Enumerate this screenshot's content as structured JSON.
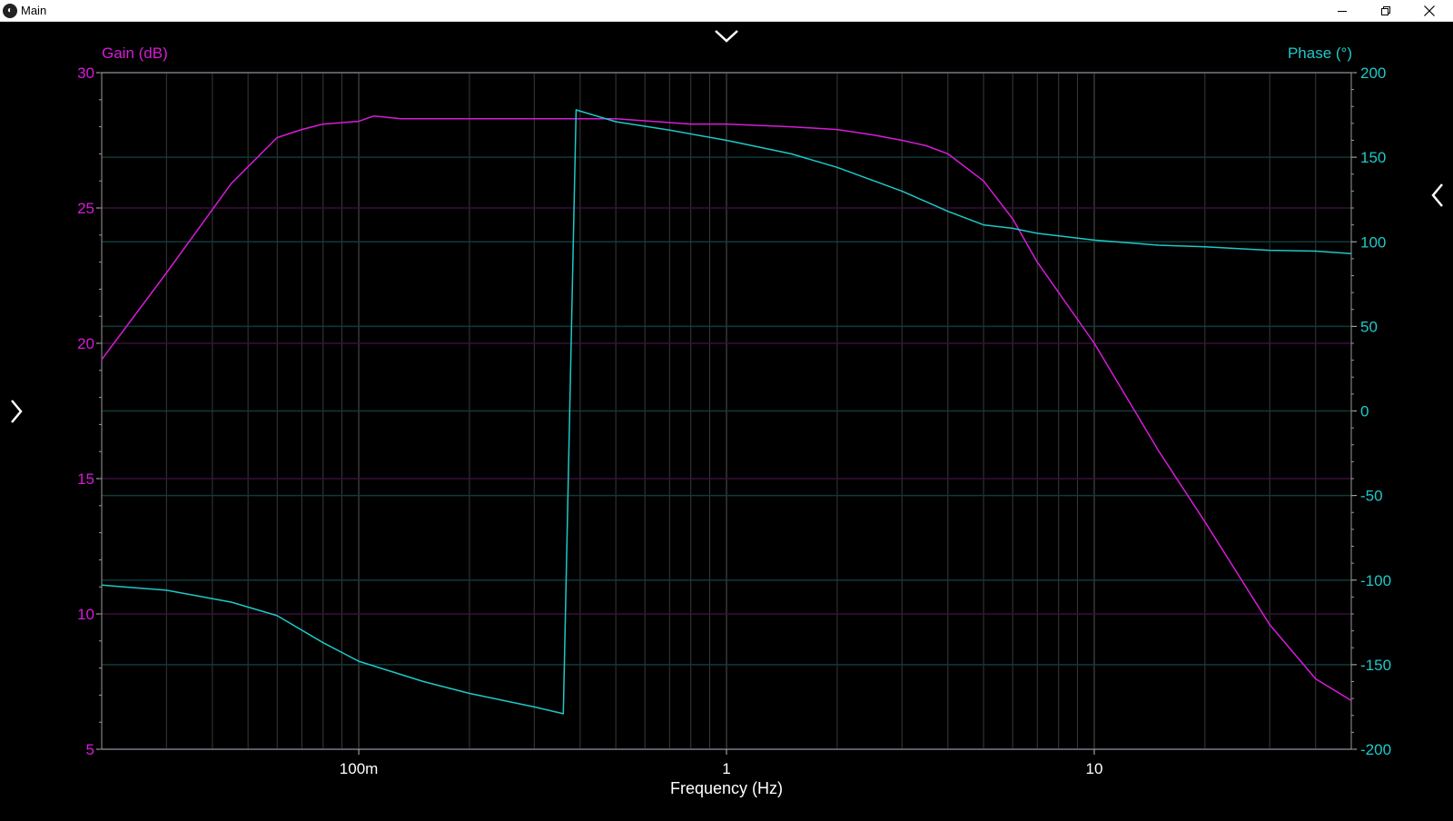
{
  "window": {
    "title": "Main",
    "icon": "app-logo-icon",
    "controls": [
      "minimize-icon",
      "restore-icon",
      "close-icon"
    ]
  },
  "nav": {
    "top_toggle_icon": "chevron-down-icon",
    "left_toggle_icon": "chevron-right-icon",
    "right_toggle_icon": "chevron-left-icon"
  },
  "colors": {
    "background": "#000000",
    "gain": "#d81bd8",
    "phase": "#1ec8c8",
    "gain_grid": "#3a0f3a",
    "phase_grid": "#0f3a3a",
    "freq_grid": "#3a3a3a",
    "axis_text": "#ffffff"
  },
  "chart_data": {
    "type": "line",
    "xlabel": "Frequency (Hz)",
    "xscale": "log",
    "xlim": [
      0.02,
      50
    ],
    "xticks": [
      {
        "value": 0.1,
        "label": "100m"
      },
      {
        "value": 1,
        "label": "1"
      },
      {
        "value": 10,
        "label": "10"
      }
    ],
    "y_left": {
      "label": "Gain (dB)",
      "lim": [
        5,
        30
      ],
      "ticks": [
        5,
        10,
        15,
        20,
        25,
        30
      ]
    },
    "y_right": {
      "label": "Phase (°)",
      "lim": [
        -200,
        200
      ],
      "ticks": [
        -200,
        -150,
        -100,
        -50,
        0,
        50,
        100,
        150,
        200
      ]
    },
    "grid": true,
    "series": [
      {
        "name": "Gain (dB)",
        "axis": "left",
        "color": "#d81bd8",
        "points": [
          [
            0.02,
            19.4
          ],
          [
            0.03,
            22.6
          ],
          [
            0.045,
            25.9
          ],
          [
            0.06,
            27.6
          ],
          [
            0.07,
            27.9
          ],
          [
            0.08,
            28.1
          ],
          [
            0.1,
            28.2
          ],
          [
            0.11,
            28.4
          ],
          [
            0.13,
            28.3
          ],
          [
            0.2,
            28.3
          ],
          [
            0.3,
            28.3
          ],
          [
            0.5,
            28.3
          ],
          [
            0.8,
            28.1
          ],
          [
            1.0,
            28.1
          ],
          [
            1.5,
            28.0
          ],
          [
            2.0,
            27.9
          ],
          [
            2.5,
            27.7
          ],
          [
            3.0,
            27.5
          ],
          [
            3.5,
            27.3
          ],
          [
            4.0,
            27.0
          ],
          [
            5.0,
            26.0
          ],
          [
            6.0,
            24.6
          ],
          [
            7.0,
            23.0
          ],
          [
            10.0,
            20.0
          ],
          [
            15.0,
            16.0
          ],
          [
            20.0,
            13.4
          ],
          [
            30.0,
            9.6
          ],
          [
            40.0,
            7.6
          ],
          [
            50.0,
            6.8
          ]
        ]
      },
      {
        "name": "Phase (°)",
        "axis": "right",
        "color": "#1ec8c8",
        "points": [
          [
            0.02,
            -103
          ],
          [
            0.03,
            -106
          ],
          [
            0.045,
            -113
          ],
          [
            0.06,
            -121
          ],
          [
            0.08,
            -137
          ],
          [
            0.1,
            -148
          ],
          [
            0.15,
            -160
          ],
          [
            0.2,
            -167
          ],
          [
            0.3,
            -175
          ],
          [
            0.36,
            -179
          ],
          [
            0.39,
            178
          ],
          [
            0.5,
            171
          ],
          [
            0.7,
            166
          ],
          [
            1.0,
            160
          ],
          [
            1.5,
            152
          ],
          [
            2.0,
            144
          ],
          [
            3.0,
            130
          ],
          [
            4.0,
            118
          ],
          [
            5.0,
            110
          ],
          [
            6.0,
            108
          ],
          [
            7.0,
            105
          ],
          [
            10.0,
            101
          ],
          [
            15.0,
            98
          ],
          [
            20.0,
            97
          ],
          [
            30.0,
            95
          ],
          [
            40.0,
            94.5
          ],
          [
            50.0,
            93
          ]
        ]
      }
    ]
  }
}
